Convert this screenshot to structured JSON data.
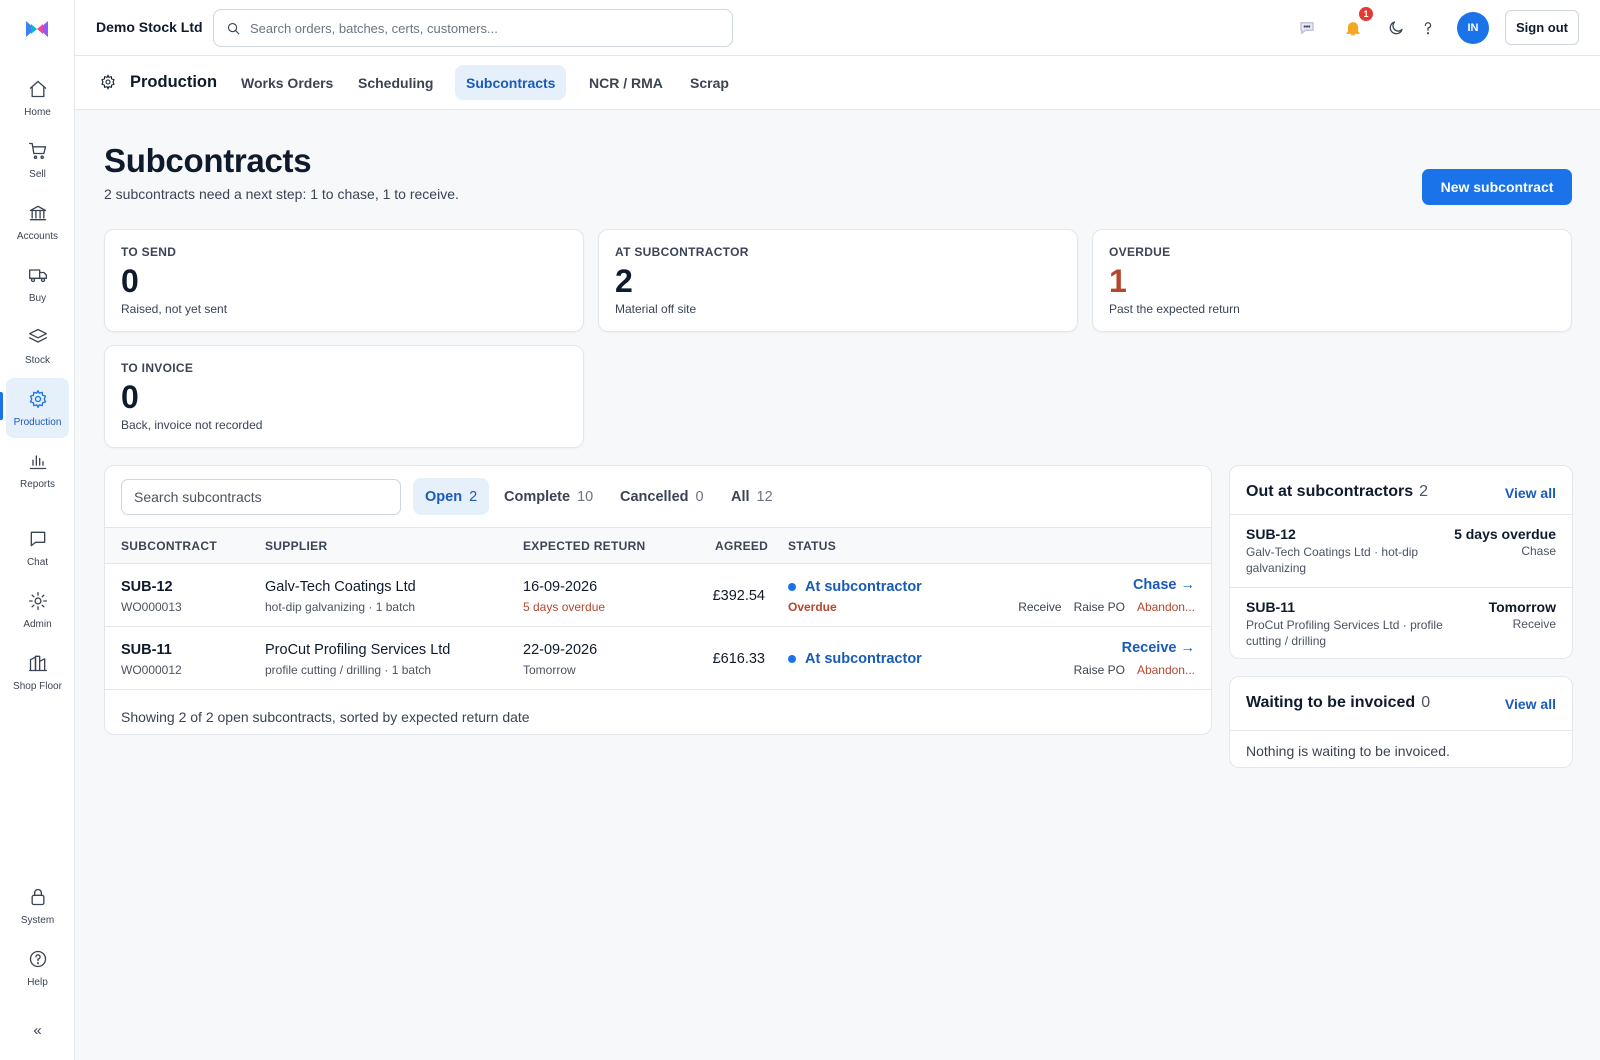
{
  "app": {
    "company": "Demo Stock Ltd"
  },
  "search": {
    "placeholder": "Search orders, batches, certs, customers..."
  },
  "topbar": {
    "notif_count": "1",
    "avatar": "IN",
    "signout": "Sign out"
  },
  "sidebar": {
    "items": [
      {
        "label": "Home",
        "icon": "home-icon"
      },
      {
        "label": "Sell",
        "icon": "cart-icon"
      },
      {
        "label": "Accounts",
        "icon": "bank-icon"
      },
      {
        "label": "Buy",
        "icon": "truck-icon"
      },
      {
        "label": "Stock",
        "icon": "layers-icon"
      },
      {
        "label": "Production",
        "icon": "gear-icon"
      },
      {
        "label": "Reports",
        "icon": "bar-chart-icon"
      },
      {
        "label": "Chat",
        "icon": "chat-icon"
      },
      {
        "label": "Admin",
        "icon": "sun-icon"
      },
      {
        "label": "Shop Floor",
        "icon": "factory-icon"
      },
      {
        "label": "System",
        "icon": "lock-icon"
      },
      {
        "label": "Help",
        "icon": "help-icon"
      }
    ],
    "active": "Production",
    "collapse": "«"
  },
  "subnav": {
    "section": "Production",
    "tabs": [
      "Works Orders",
      "Scheduling",
      "Subcontracts",
      "NCR / RMA",
      "Scrap"
    ],
    "active": "Subcontracts"
  },
  "page": {
    "title": "Subcontracts",
    "subtitle": "2 subcontracts need a next step: 1 to chase, 1 to receive.",
    "new_button": "New subcontract"
  },
  "kpis": [
    {
      "label": "TO SEND",
      "value": "0",
      "sub": "Raised, not yet sent"
    },
    {
      "label": "AT SUBCONTRACTOR",
      "value": "2",
      "sub": "Material off site"
    },
    {
      "label": "OVERDUE",
      "value": "1",
      "sub": "Past the expected return"
    },
    {
      "label": "TO INVOICE",
      "value": "0",
      "sub": "Back, invoice not recorded"
    }
  ],
  "table": {
    "search_placeholder": "Search subcontracts",
    "filters": [
      {
        "label": "Open",
        "count": "2"
      },
      {
        "label": "Complete",
        "count": "10"
      },
      {
        "label": "Cancelled",
        "count": "0"
      },
      {
        "label": "All",
        "count": "12"
      }
    ],
    "active_filter": "Open",
    "columns": [
      "SUBCONTRACT",
      "SUPPLIER",
      "EXPECTED RETURN",
      "AGREED",
      "STATUS"
    ],
    "rows": [
      {
        "id": "SUB-12",
        "wo": "WO000013",
        "supplier": "Galv-Tech Coatings Ltd",
        "supplier_detail": "hot-dip galvanizing · 1 batch",
        "date": "16-09-2026",
        "date_detail": "5 days overdue",
        "amount": "£392.54",
        "status": "At subcontractor",
        "status_detail": "Overdue",
        "primary_action": "Chase →",
        "actions": [
          "Receive",
          "Raise PO",
          "Abandon..."
        ]
      },
      {
        "id": "SUB-11",
        "wo": "WO000012",
        "supplier": "ProCut Profiling Services Ltd",
        "supplier_detail": "profile cutting / drilling · 1 batch",
        "date": "22-09-2026",
        "date_detail": "Tomorrow",
        "amount": "£616.33",
        "status": "At subcontractor",
        "status_detail": "",
        "primary_action": "Receive →",
        "actions": [
          "Raise PO",
          "Abandon..."
        ]
      }
    ],
    "footer": "Showing 2 of 2 open subcontracts, sorted by expected return date"
  },
  "out_panel": {
    "title": "Out at subcontractors",
    "count": "2",
    "link": "View all",
    "items": [
      {
        "id": "SUB-12",
        "desc": "Galv-Tech Coatings Ltd · hot-dip galvanizing",
        "when": "5 days overdue",
        "action": "Chase"
      },
      {
        "id": "SUB-11",
        "desc": "ProCut Profiling Services Ltd · profile cutting / drilling",
        "when": "Tomorrow",
        "action": "Receive"
      }
    ]
  },
  "invoice_panel": {
    "title": "Waiting to be invoiced",
    "count": "0",
    "link": "View all",
    "empty": "Nothing is waiting to be invoiced."
  },
  "colors": {
    "accent": "#1a73e8",
    "accent_text": "#1a5bb8",
    "danger": "#b4482e",
    "badge": "#e53935"
  }
}
